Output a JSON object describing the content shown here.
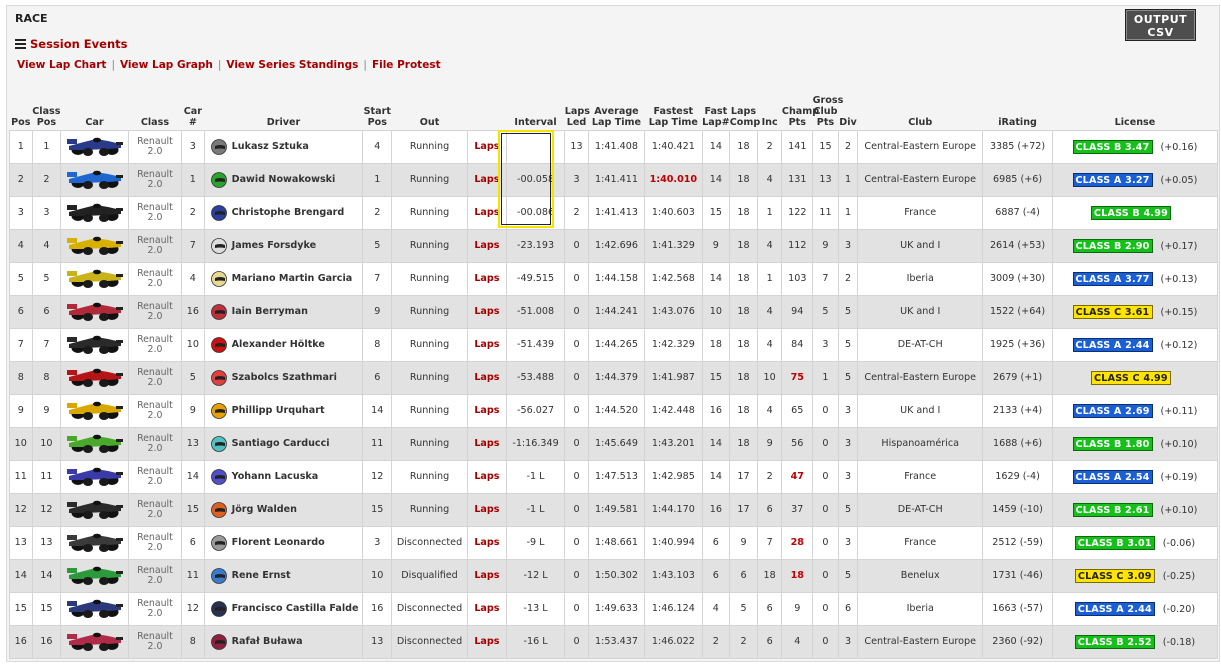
{
  "header": {
    "title": "RACE",
    "session_events": "Session Events",
    "output_csv_line1": "OUTPUT",
    "output_csv_line2": "CSV",
    "links": [
      "View Lap Chart",
      "View Lap Graph",
      "View Series Standings",
      "File Protest"
    ]
  },
  "columns": {
    "pos": "Pos",
    "class_pos": [
      "Class",
      "Pos"
    ],
    "car": "Car",
    "class": "Class",
    "car_num": [
      "Car",
      "#"
    ],
    "driver": "Driver",
    "start_pos": [
      "Start",
      "Pos"
    ],
    "out": "Out",
    "interval": "Interval",
    "laps_led": [
      "Laps",
      "Led"
    ],
    "avg_lap": [
      "Average",
      "Lap Time"
    ],
    "fastest_lap": [
      "Fastest",
      "Lap Time"
    ],
    "fast_lap_num": [
      "Fast",
      "Lap#"
    ],
    "laps_comp": [
      "Laps",
      "Comp"
    ],
    "inc": "Inc",
    "champ_pts": [
      "Champ",
      "Pts"
    ],
    "club_pts": [
      "Gross",
      "Club",
      "Pts"
    ],
    "div": "Div",
    "club": "Club",
    "irating": "iRating",
    "license": "License"
  },
  "colors": {
    "link_red": "#a30000",
    "license_green": "#16c01a",
    "license_blue": "#1b5fd6",
    "license_yellow": "#ffe400",
    "highlight_yellow": "#f2e400"
  },
  "rows": [
    {
      "pos": "1",
      "class_pos": "1",
      "car_color": "#2a3a8a",
      "class_line1": "Renault",
      "class_line2": "2.0",
      "car_num": "3",
      "driver": "Lukasz Sztuka",
      "helmet": "#7a7a7a",
      "start_pos": "4",
      "out": "Running",
      "laps_link": "Laps",
      "interval": "",
      "laps_led": "13",
      "avg_lap": "1:41.408",
      "fastest_lap": "1:40.421",
      "fastest_red": false,
      "fast_lap_num": "14",
      "laps_comp": "18",
      "inc": "2",
      "champ_pts": "141",
      "champ_red": false,
      "club_pts": "15",
      "div": "2",
      "club": "Central-Eastern Europe",
      "irating": "3385",
      "irating_delta": "(+72)",
      "license": "CLASS B 3.47",
      "license_color": "green",
      "license_delta": "(+0.16)"
    },
    {
      "pos": "2",
      "class_pos": "2",
      "car_color": "#1f66d0",
      "class_line1": "Renault",
      "class_line2": "2.0",
      "car_num": "1",
      "driver": "Dawid Nowakowski",
      "helmet": "#2aa52a",
      "start_pos": "1",
      "out": "Running",
      "laps_link": "Laps",
      "interval": "-00.058",
      "laps_led": "3",
      "avg_lap": "1:41.411",
      "fastest_lap": "1:40.010",
      "fastest_red": true,
      "fast_lap_num": "14",
      "laps_comp": "18",
      "inc": "4",
      "champ_pts": "131",
      "champ_red": false,
      "club_pts": "13",
      "div": "1",
      "club": "Central-Eastern Europe",
      "irating": "6985",
      "irating_delta": "(+6)",
      "license": "CLASS A 3.27",
      "license_color": "blue",
      "license_delta": "(+0.05)"
    },
    {
      "pos": "3",
      "class_pos": "3",
      "car_color": "#222222",
      "class_line1": "Renault",
      "class_line2": "2.0",
      "car_num": "2",
      "driver": "Christophe Brengard",
      "helmet": "#2a3fa0",
      "start_pos": "2",
      "out": "Running",
      "laps_link": "Laps",
      "interval": "-00.086",
      "laps_led": "2",
      "avg_lap": "1:41.413",
      "fastest_lap": "1:40.603",
      "fastest_red": false,
      "fast_lap_num": "15",
      "laps_comp": "18",
      "inc": "1",
      "champ_pts": "122",
      "champ_red": false,
      "club_pts": "11",
      "div": "1",
      "club": "France",
      "irating": "6887",
      "irating_delta": "(-4)",
      "license": "CLASS B 4.99",
      "license_color": "green",
      "license_delta": ""
    },
    {
      "pos": "4",
      "class_pos": "4",
      "car_color": "#d8b000",
      "class_line1": "Renault",
      "class_line2": "2.0",
      "car_num": "7",
      "driver": "James Forsdyke",
      "helmet": "#dddddd",
      "start_pos": "5",
      "out": "Running",
      "laps_link": "Laps",
      "interval": "-23.193",
      "laps_led": "0",
      "avg_lap": "1:42.696",
      "fastest_lap": "1:41.329",
      "fastest_red": false,
      "fast_lap_num": "9",
      "laps_comp": "18",
      "inc": "4",
      "champ_pts": "112",
      "champ_red": false,
      "club_pts": "9",
      "div": "3",
      "club": "UK and I",
      "irating": "2614",
      "irating_delta": "(+53)",
      "license": "CLASS B 2.90",
      "license_color": "green",
      "license_delta": "(+0.17)"
    },
    {
      "pos": "5",
      "class_pos": "5",
      "car_color": "#c9b21a",
      "class_line1": "Renault",
      "class_line2": "2.0",
      "car_num": "4",
      "driver": "Mariano Martin Garcia",
      "helmet": "#e8d890",
      "start_pos": "7",
      "out": "Running",
      "laps_link": "Laps",
      "interval": "-49.515",
      "laps_led": "0",
      "avg_lap": "1:44.158",
      "fastest_lap": "1:42.568",
      "fastest_red": false,
      "fast_lap_num": "14",
      "laps_comp": "18",
      "inc": "1",
      "champ_pts": "103",
      "champ_red": false,
      "club_pts": "7",
      "div": "2",
      "club": "Iberia",
      "irating": "3009",
      "irating_delta": "(+30)",
      "license": "CLASS A 3.77",
      "license_color": "blue",
      "license_delta": "(+0.13)"
    },
    {
      "pos": "6",
      "class_pos": "6",
      "car_color": "#b02a3a",
      "class_line1": "Renault",
      "class_line2": "2.0",
      "car_num": "16",
      "driver": "Iain Berryman",
      "helmet": "#c0303a",
      "start_pos": "9",
      "out": "Running",
      "laps_link": "Laps",
      "interval": "-51.008",
      "laps_led": "0",
      "avg_lap": "1:44.241",
      "fastest_lap": "1:43.076",
      "fastest_red": false,
      "fast_lap_num": "10",
      "laps_comp": "18",
      "inc": "4",
      "champ_pts": "94",
      "champ_red": false,
      "club_pts": "5",
      "div": "5",
      "club": "UK and I",
      "irating": "1522",
      "irating_delta": "(+64)",
      "license": "CLASS C 3.61",
      "license_color": "yellow",
      "license_delta": "(+0.15)"
    },
    {
      "pos": "7",
      "class_pos": "7",
      "car_color": "#2a2a2a",
      "class_line1": "Renault",
      "class_line2": "2.0",
      "car_num": "10",
      "driver": "Alexander Höltke",
      "helmet": "#cc1111",
      "start_pos": "8",
      "out": "Running",
      "laps_link": "Laps",
      "interval": "-51.439",
      "laps_led": "0",
      "avg_lap": "1:44.265",
      "fastest_lap": "1:42.329",
      "fastest_red": false,
      "fast_lap_num": "18",
      "laps_comp": "18",
      "inc": "4",
      "champ_pts": "84",
      "champ_red": false,
      "club_pts": "3",
      "div": "5",
      "club": "DE-AT-CH",
      "irating": "1925",
      "irating_delta": "(+36)",
      "license": "CLASS A 2.44",
      "license_color": "blue",
      "license_delta": "(+0.12)"
    },
    {
      "pos": "8",
      "class_pos": "8",
      "car_color": "#b51515",
      "class_line1": "Renault",
      "class_line2": "2.0",
      "car_num": "5",
      "driver": "Szabolcs Szathmari",
      "helmet": "#e04040",
      "start_pos": "6",
      "out": "Running",
      "laps_link": "Laps",
      "interval": "-53.488",
      "laps_led": "0",
      "avg_lap": "1:44.379",
      "fastest_lap": "1:41.987",
      "fastest_red": false,
      "fast_lap_num": "15",
      "laps_comp": "18",
      "inc": "10",
      "champ_pts": "75",
      "champ_red": true,
      "club_pts": "1",
      "div": "5",
      "club": "Central-Eastern Europe",
      "irating": "2679",
      "irating_delta": "(+1)",
      "license": "CLASS C 4.99",
      "license_color": "yellow",
      "license_delta": ""
    },
    {
      "pos": "9",
      "class_pos": "9",
      "car_color": "#d8a800",
      "class_line1": "Renault",
      "class_line2": "2.0",
      "car_num": "9",
      "driver": "Phillipp Urquhart",
      "helmet": "#e8a000",
      "start_pos": "14",
      "out": "Running",
      "laps_link": "Laps",
      "interval": "-56.027",
      "laps_led": "0",
      "avg_lap": "1:44.520",
      "fastest_lap": "1:42.448",
      "fastest_red": false,
      "fast_lap_num": "16",
      "laps_comp": "18",
      "inc": "4",
      "champ_pts": "65",
      "champ_red": false,
      "club_pts": "0",
      "div": "3",
      "club": "UK and I",
      "irating": "2133",
      "irating_delta": "(+4)",
      "license": "CLASS A 2.69",
      "license_color": "blue",
      "license_delta": "(+0.11)"
    },
    {
      "pos": "10",
      "class_pos": "10",
      "car_color": "#4aa82a",
      "class_line1": "Renault",
      "class_line2": "2.0",
      "car_num": "13",
      "driver": "Santiago Carducci",
      "helmet": "#50c0c0",
      "start_pos": "11",
      "out": "Running",
      "laps_link": "Laps",
      "interval": "-1:16.349",
      "laps_led": "0",
      "avg_lap": "1:45.649",
      "fastest_lap": "1:43.201",
      "fastest_red": false,
      "fast_lap_num": "14",
      "laps_comp": "18",
      "inc": "9",
      "champ_pts": "56",
      "champ_red": false,
      "club_pts": "0",
      "div": "3",
      "club": "Hispanoamérica",
      "irating": "1688",
      "irating_delta": "(+6)",
      "license": "CLASS B 1.80",
      "license_color": "green",
      "license_delta": "(+0.10)"
    },
    {
      "pos": "11",
      "class_pos": "11",
      "car_color": "#3a3aa8",
      "class_line1": "Renault",
      "class_line2": "2.0",
      "car_num": "14",
      "driver": "Yohann Lacuska",
      "helmet": "#5050c8",
      "start_pos": "12",
      "out": "Running",
      "laps_link": "Laps",
      "interval": "-1 L",
      "laps_led": "0",
      "avg_lap": "1:47.513",
      "fastest_lap": "1:42.985",
      "fastest_red": false,
      "fast_lap_num": "14",
      "laps_comp": "17",
      "inc": "2",
      "champ_pts": "47",
      "champ_red": true,
      "club_pts": "0",
      "div": "3",
      "club": "France",
      "irating": "1629",
      "irating_delta": "(-4)",
      "license": "CLASS A 2.54",
      "license_color": "blue",
      "license_delta": "(+0.19)"
    },
    {
      "pos": "12",
      "class_pos": "12",
      "car_color": "#2a2a2a",
      "class_line1": "Renault",
      "class_line2": "2.0",
      "car_num": "15",
      "driver": "Jörg Walden",
      "helmet": "#e06020",
      "start_pos": "15",
      "out": "Running",
      "laps_link": "Laps",
      "interval": "-1 L",
      "laps_led": "0",
      "avg_lap": "1:49.581",
      "fastest_lap": "1:44.170",
      "fastest_red": false,
      "fast_lap_num": "16",
      "laps_comp": "17",
      "inc": "6",
      "champ_pts": "37",
      "champ_red": false,
      "club_pts": "0",
      "div": "5",
      "club": "DE-AT-CH",
      "irating": "1459",
      "irating_delta": "(-10)",
      "license": "CLASS B 2.61",
      "license_color": "green",
      "license_delta": "(+0.10)"
    },
    {
      "pos": "13",
      "class_pos": "13",
      "car_color": "#3a3a3a",
      "class_line1": "Renault",
      "class_line2": "2.0",
      "car_num": "6",
      "driver": "Florent Leonardo",
      "helmet": "#9a9a9a",
      "start_pos": "3",
      "out": "Disconnected",
      "laps_link": "Laps",
      "interval": "-9 L",
      "laps_led": "0",
      "avg_lap": "1:48.661",
      "fastest_lap": "1:40.994",
      "fastest_red": false,
      "fast_lap_num": "6",
      "laps_comp": "9",
      "inc": "7",
      "champ_pts": "28",
      "champ_red": true,
      "club_pts": "0",
      "div": "3",
      "club": "France",
      "irating": "2512",
      "irating_delta": "(-59)",
      "license": "CLASS B 3.01",
      "license_color": "green",
      "license_delta": "(-0.06)"
    },
    {
      "pos": "14",
      "class_pos": "14",
      "car_color": "#2a9a3a",
      "class_line1": "Renault",
      "class_line2": "2.0",
      "car_num": "11",
      "driver": "Rene Ernst",
      "helmet": "#3a7ad0",
      "start_pos": "10",
      "out": "Disqualified",
      "laps_link": "Laps",
      "interval": "-12 L",
      "laps_led": "0",
      "avg_lap": "1:50.302",
      "fastest_lap": "1:43.103",
      "fastest_red": false,
      "fast_lap_num": "6",
      "laps_comp": "6",
      "inc": "18",
      "champ_pts": "18",
      "champ_red": true,
      "club_pts": "0",
      "div": "5",
      "club": "Benelux",
      "irating": "1731",
      "irating_delta": "(-46)",
      "license": "CLASS C 3.09",
      "license_color": "yellow",
      "license_delta": "(-0.25)"
    },
    {
      "pos": "15",
      "class_pos": "15",
      "car_color": "#2a3a7a",
      "class_line1": "Renault",
      "class_line2": "2.0",
      "car_num": "12",
      "driver": "Francisco Castilla Falde",
      "helmet": "#2a3050",
      "start_pos": "16",
      "out": "Disconnected",
      "laps_link": "Laps",
      "interval": "-13 L",
      "laps_led": "0",
      "avg_lap": "1:49.633",
      "fastest_lap": "1:46.124",
      "fastest_red": false,
      "fast_lap_num": "4",
      "laps_comp": "5",
      "inc": "6",
      "champ_pts": "9",
      "champ_red": false,
      "club_pts": "0",
      "div": "6",
      "club": "Iberia",
      "irating": "1663",
      "irating_delta": "(-57)",
      "license": "CLASS A 2.44",
      "license_color": "blue",
      "license_delta": "(-0.20)"
    },
    {
      "pos": "16",
      "class_pos": "16",
      "car_color": "#b02a4a",
      "class_line1": "Renault",
      "class_line2": "2.0",
      "car_num": "8",
      "driver": "Rafał Buława",
      "helmet": "#902040",
      "start_pos": "13",
      "out": "Disconnected",
      "laps_link": "Laps",
      "interval": "-16 L",
      "laps_led": "0",
      "avg_lap": "1:53.437",
      "fastest_lap": "1:46.022",
      "fastest_red": false,
      "fast_lap_num": "2",
      "laps_comp": "2",
      "inc": "6",
      "champ_pts": "4",
      "champ_red": false,
      "club_pts": "0",
      "div": "3",
      "club": "Central-Eastern Europe",
      "irating": "2360",
      "irating_delta": "(-92)",
      "license": "CLASS B 2.52",
      "license_color": "green",
      "license_delta": "(-0.18)"
    }
  ]
}
